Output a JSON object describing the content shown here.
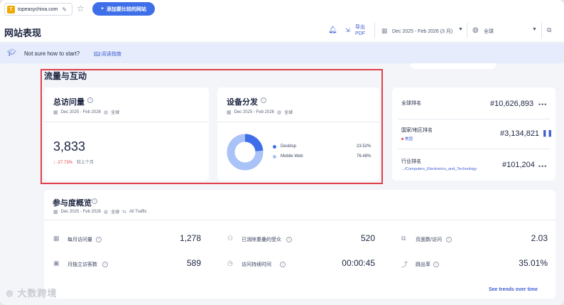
{
  "topbar": {
    "site_domain": "topeasychina.com",
    "favicon_letter": "T",
    "add_button_label": "添加要比较的网站"
  },
  "header": {
    "page_title": "网站表现",
    "export_label_line1": "导出",
    "export_label_line2": "PDF",
    "date_range": "Dec 2025 - Feb 2026 (3 月)",
    "region": "全球"
  },
  "banner": {
    "text": "Not sure how to start?",
    "link": "阅读指南"
  },
  "traffic_section": {
    "title": "流量与互动",
    "visits_card": {
      "title": "总访问量",
      "date": "Dec 2025 - Feb 2026",
      "region": "全球",
      "value": "3,833",
      "change": "-27.73%",
      "change_note": "较上个月"
    },
    "device_card": {
      "title": "设备分发",
      "date": "Dec 2025 - Feb 2026",
      "region": "全球",
      "legend": [
        {
          "name": "Desktop",
          "value": "23.52%",
          "color": "#3f6fe8",
          "share": 0.2352
        },
        {
          "name": "Mobile Web",
          "value": "76.48%",
          "color": "#a9c2f7",
          "share": 0.7648
        }
      ]
    }
  },
  "ranks": {
    "global": {
      "label": "全球排名",
      "value": "#10,626,893"
    },
    "country": {
      "label": "国家/地区排名",
      "sub": "美国",
      "value": "#3,134,821"
    },
    "industry": {
      "label": "行业排名",
      "sub": ".../Computers_Electronics_and_Technology",
      "value": "#101,204"
    }
  },
  "engagement": {
    "title": "参与度概览",
    "date": "Dec 2025 - Feb 2026",
    "region": "全球",
    "traffic": "All Traffic",
    "metrics": [
      {
        "label": "每月访问量",
        "value": "1,278"
      },
      {
        "label": "已消除重叠的受众",
        "value": "520"
      },
      {
        "label": "页面数/访问",
        "value": "2.03"
      },
      {
        "label": "月独立访客数",
        "value": "589"
      },
      {
        "label": "访问持续时间",
        "value": "00:00:45"
      },
      {
        "label": "跳出率",
        "value": "35.01%"
      }
    ],
    "trends_link": "See trends over time"
  },
  "watermark": "大数跨境"
}
